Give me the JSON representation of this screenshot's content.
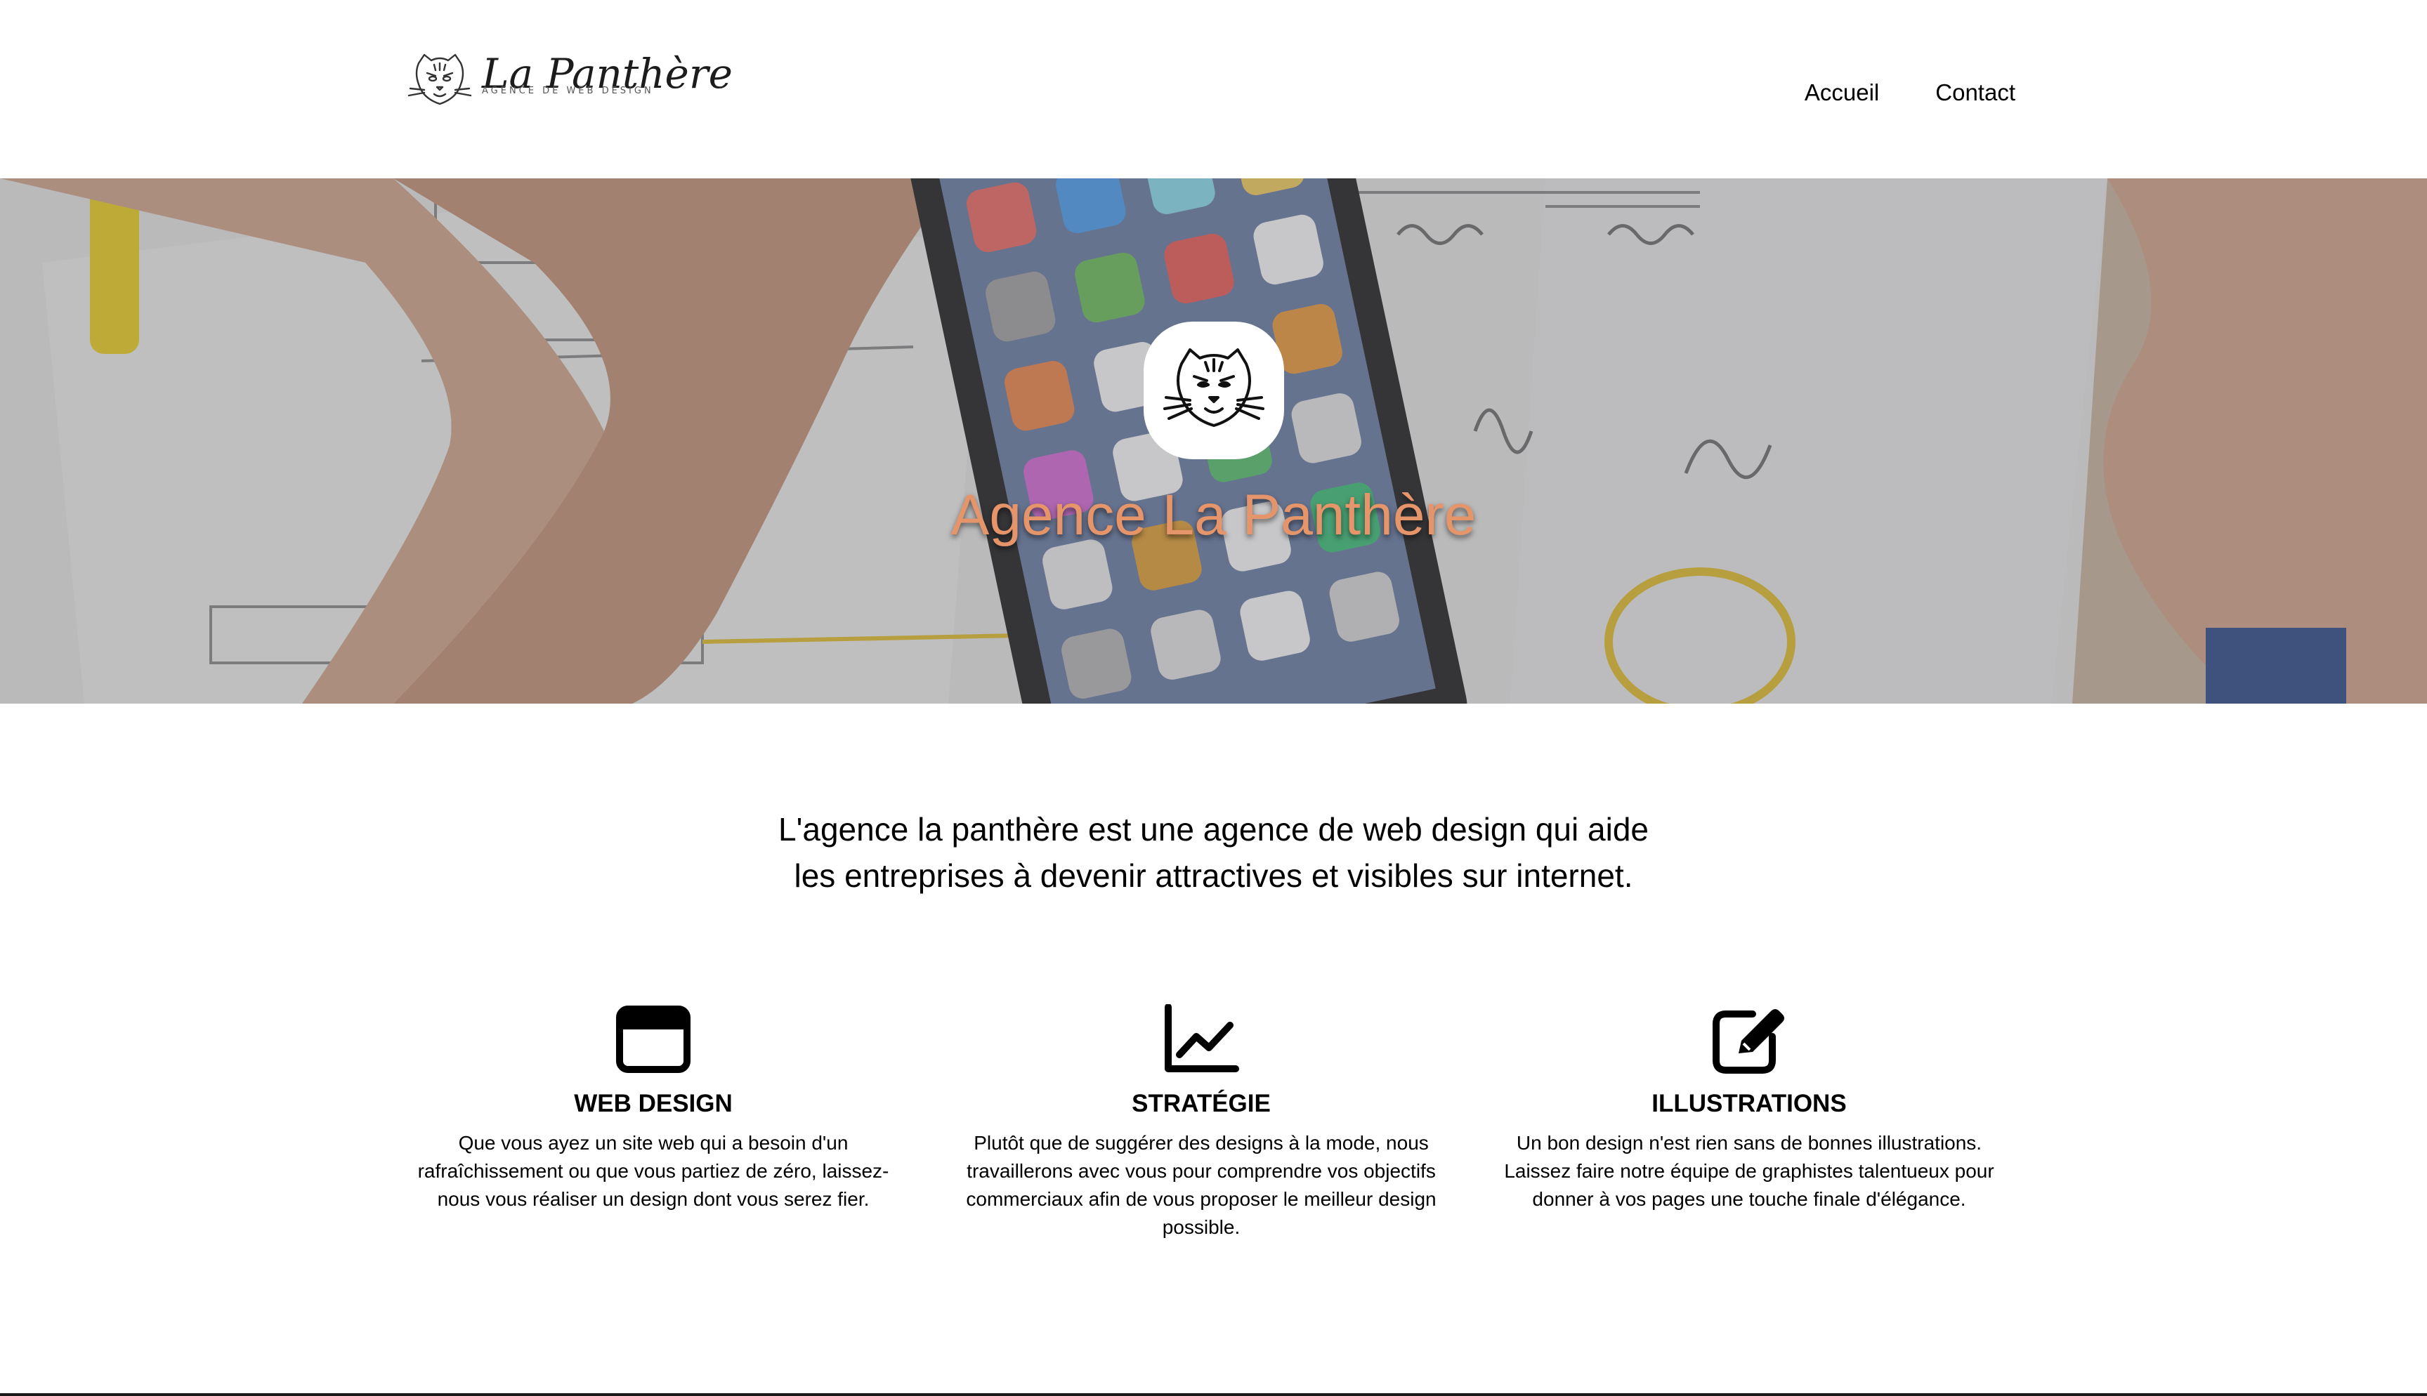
{
  "header": {
    "logo": {
      "name": "La Panthère",
      "tagline": "AGENCE DE WEB DESIGN"
    },
    "nav": [
      {
        "label": "Accueil"
      },
      {
        "label": "Contact"
      }
    ]
  },
  "hero": {
    "title": "Agence La Panthère",
    "emblem_icon": "panther-head-icon",
    "title_color": "#e6956a"
  },
  "intro": {
    "line1": "L'agence la panthère est une agence de web design qui aide",
    "line2": "les entreprises à devenir attractives et visibles sur internet."
  },
  "features": [
    {
      "icon": "browser-window-icon",
      "title": "WEB DESIGN",
      "text": "Que vous ayez un site web qui a besoin d'un rafraîchissement ou que vous partiez de zéro, laissez-nous vous réaliser un design dont vous serez fier."
    },
    {
      "icon": "line-chart-icon",
      "title": "STRATÉGIE",
      "text": "Plutôt que de suggérer des designs à la mode, nous travaillerons avec vous pour comprendre vos objectifs commerciaux afin de vous proposer le meilleur design possible."
    },
    {
      "icon": "pen-square-icon",
      "title": "ILLUSTRATIONS",
      "text": "Un bon design n'est rien sans de bonnes illustrations. Laissez faire notre équipe de graphistes talentueux pour donner à vos pages une touche finale d'élégance."
    }
  ]
}
